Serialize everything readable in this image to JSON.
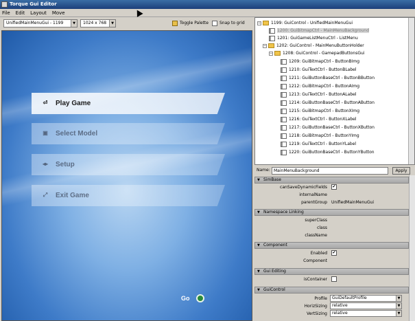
{
  "window": {
    "title": "Torque Gui Editor"
  },
  "menu": [
    "File",
    "Edit",
    "Layout",
    "Move"
  ],
  "toolbar": {
    "gui_select": "UnifiedMainMenuGui - 1199",
    "resolution": "1024 x 768",
    "toggle_palette": "Toggle Palette",
    "snap_to_grid": "Snap to grid"
  },
  "canvas": {
    "buttons": [
      {
        "label": "Play Game",
        "icon": "play-icon"
      },
      {
        "label": "Select Model",
        "icon": "model-icon"
      },
      {
        "label": "Setup",
        "icon": "setup-icon"
      },
      {
        "label": "Exit Game",
        "icon": "exit-icon"
      }
    ],
    "go_label": "Go"
  },
  "tree": [
    {
      "label": "1199: GuiControl - UnifiedMainMenuGui",
      "depth": 0,
      "kind": "folder"
    },
    {
      "label": "1200: GuiBitmapCtrl - MainMenuBackground",
      "depth": 1,
      "kind": "ctrl",
      "selected": true
    },
    {
      "label": "1201: GuiGameListMenuCtrl - ListMenu",
      "depth": 1,
      "kind": "ctrl"
    },
    {
      "label": "1202: GuiControl - MainMenuButtonHolder",
      "depth": 1,
      "kind": "folder"
    },
    {
      "label": "1208: GuiControl - GamepadButtonsGui",
      "depth": 2,
      "kind": "folder"
    },
    {
      "label": "1209: GuiBitmapCtrl - ButtonBImg",
      "depth": 3,
      "kind": "ctrl"
    },
    {
      "label": "1210: GuiTextCtrl - ButtonBLabel",
      "depth": 3,
      "kind": "ctrl"
    },
    {
      "label": "1211: GuiButtonBaseCtrl - ButtonBButton",
      "depth": 3,
      "kind": "ctrl"
    },
    {
      "label": "1212: GuiBitmapCtrl - ButtonAImg",
      "depth": 3,
      "kind": "ctrl"
    },
    {
      "label": "1213: GuiTextCtrl - ButtonALabel",
      "depth": 3,
      "kind": "ctrl"
    },
    {
      "label": "1214: GuiButtonBaseCtrl - ButtonAButton",
      "depth": 3,
      "kind": "ctrl"
    },
    {
      "label": "1215: GuiBitmapCtrl - ButtonXImg",
      "depth": 3,
      "kind": "ctrl"
    },
    {
      "label": "1216: GuiTextCtrl - ButtonXLabel",
      "depth": 3,
      "kind": "ctrl"
    },
    {
      "label": "1217: GuiButtonBaseCtrl - ButtonXButton",
      "depth": 3,
      "kind": "ctrl"
    },
    {
      "label": "1218: GuiBitmapCtrl - ButtonYImg",
      "depth": 3,
      "kind": "ctrl"
    },
    {
      "label": "1219: GuiTextCtrl - ButtonYLabel",
      "depth": 3,
      "kind": "ctrl"
    },
    {
      "label": "1220: GuiButtonBaseCtrl - ButtonYButton",
      "depth": 3,
      "kind": "ctrl"
    }
  ],
  "inspector": {
    "name_label": "Name:",
    "name_value": "MainMenuBackground",
    "apply_label": "Apply",
    "sections": [
      {
        "title": "SimBase",
        "props": [
          {
            "key": "canSaveDynamicFields",
            "type": "checkbox",
            "checked": true
          },
          {
            "key": "internalName",
            "type": "text",
            "value": ""
          },
          {
            "key": "parentGroup",
            "type": "text",
            "value": "UnifiedMainMenuGui"
          }
        ]
      },
      {
        "title": "Namespace Linking",
        "props": [
          {
            "key": "superClass",
            "type": "text",
            "value": ""
          },
          {
            "key": "class",
            "type": "text",
            "value": ""
          },
          {
            "key": "className",
            "type": "text",
            "value": ""
          }
        ]
      },
      {
        "title": "Component",
        "props": [
          {
            "key": "Enabled",
            "type": "checkbox",
            "checked": true
          },
          {
            "key": "Component",
            "type": "text",
            "value": ""
          }
        ]
      },
      {
        "title": "Gui Editing",
        "props": [
          {
            "key": "isContainer",
            "type": "checkbox",
            "checked": false
          }
        ]
      },
      {
        "title": "GuiControl",
        "props": [
          {
            "key": "Profile",
            "type": "select",
            "value": "GuiDefaultProfile"
          },
          {
            "key": "HorizSizing",
            "type": "select",
            "value": "relative"
          },
          {
            "key": "VertSizing",
            "type": "select",
            "value": "relative"
          }
        ]
      }
    ]
  }
}
